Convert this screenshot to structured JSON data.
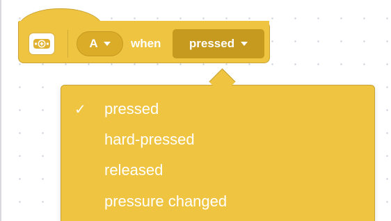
{
  "block": {
    "port_value": "A",
    "when_label": "when",
    "event_value": "pressed",
    "icon": "force-sensor-icon"
  },
  "menu": {
    "items": [
      {
        "label": "pressed",
        "selected": true
      },
      {
        "label": "hard-pressed",
        "selected": false
      },
      {
        "label": "released",
        "selected": false
      },
      {
        "label": "pressure changed",
        "selected": false
      }
    ],
    "check_glyph": "✓"
  },
  "colors": {
    "block": "#efc441",
    "block_border": "#c9a334",
    "pill": "#dbac27",
    "dropdown_field": "#c6991f",
    "text": "#ffffff"
  }
}
